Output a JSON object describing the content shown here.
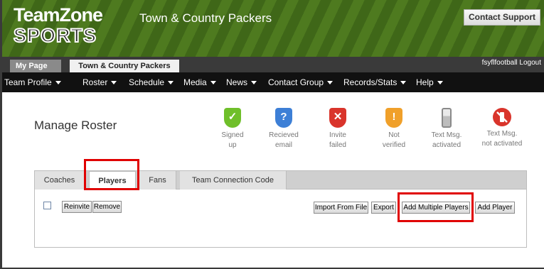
{
  "header": {
    "logo_top": "TeamZone",
    "logo_bottom": "SPORTS",
    "org_title": "Town & Country Packers",
    "contact_support": "Contact Support"
  },
  "tabs_top": {
    "my_page": "My Page",
    "team": "Town & Country Packers",
    "user_logout": "fsyflfootball Logout"
  },
  "nav": {
    "items": [
      "Team Profile",
      "Roster",
      "Schedule",
      "Media",
      "News",
      "Contact Group",
      "Records/Stats",
      "Help"
    ]
  },
  "page": {
    "title": "Manage Roster"
  },
  "legend": [
    {
      "line1": "Signed",
      "line2": "up",
      "icon": "shield-check-icon",
      "color": "#6fbf2a",
      "glyph": "✓"
    },
    {
      "line1": "Recieved",
      "line2": "email",
      "icon": "shield-question-icon",
      "color": "#3d7fd6",
      "glyph": "?"
    },
    {
      "line1": "Invite",
      "line2": "failed",
      "icon": "shield-x-icon",
      "color": "#d9342b",
      "glyph": "✕"
    },
    {
      "line1": "Not",
      "line2": "verified",
      "icon": "shield-exclamation-icon",
      "color": "#f0a02a",
      "glyph": "!"
    },
    {
      "line1": "Text Msg.",
      "line2": "activated",
      "icon": "phone-icon",
      "color": "#9a9a9a",
      "glyph": ""
    },
    {
      "line1": "Text Msg.",
      "line2": "not activated",
      "icon": "no-phone-icon",
      "color": "#d9342b",
      "glyph": ""
    }
  ],
  "roster_tabs": [
    "Coaches",
    "Players",
    "Fans",
    "Team Connection Code"
  ],
  "actions": {
    "reinvite": "Reinvite",
    "remove": "Remove",
    "import_from_file": "Import From File",
    "export": "Export",
    "add_multiple_players": "Add Multiple Players",
    "add_player": "Add Player"
  }
}
